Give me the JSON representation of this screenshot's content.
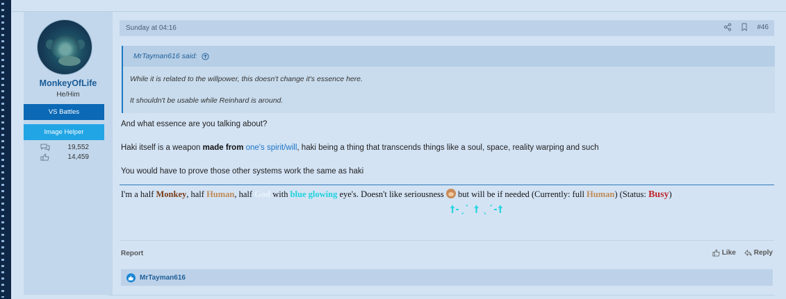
{
  "user": {
    "name": "MonkeyOfLife",
    "pronouns": "He/Him",
    "banner_primary": "VS Battles",
    "banner_secondary": "Image Helper",
    "messages": "19,552",
    "reactions": "14,459"
  },
  "post": {
    "date": "Sunday at 04:16",
    "number": "#46",
    "quote": {
      "author": "MrTayman616 said:",
      "line1": "While it is related to the willpower, this doesn't change it's essence here.",
      "line2": "It shouldn't be usable while Reinhard is around."
    },
    "para1": "And what essence are you talking about?",
    "para2_a": "Haki itself is a weapon ",
    "para2_bold": "made from",
    "para2_space": " ",
    "para2_link": "one's spirit/will",
    "para2_c": ", haki being a thing that transcends things like a soul, space, reality warping and such",
    "para3": "You would have to prove those other systems work the same as haki"
  },
  "signature": {
    "s1": "I'm a half ",
    "monkey": "Monkey",
    "s2": ", half ",
    "human": "Human",
    "s3": ", half ",
    "god": "God",
    "s4": " with ",
    "blue": "blue glowing",
    "s5": " eye's. Doesn't like seriousness ",
    "s6": " but will be if needed (Currently: full ",
    "human2": "Human",
    "s7": ") (Status: ",
    "busy": "Busy",
    "s8": ")",
    "crosses": "†-ˏˋ † ˎˊ-†"
  },
  "footer": {
    "report": "Report",
    "like": "Like",
    "reply": "Reply",
    "reacted_by": "MrTayman616"
  },
  "colors": {
    "accent": "#1e78c2",
    "banner_vs": "#0b69b6",
    "banner_helper": "#21a5e5",
    "busy": "#c0262b",
    "cyan": "#1fd3dd"
  }
}
